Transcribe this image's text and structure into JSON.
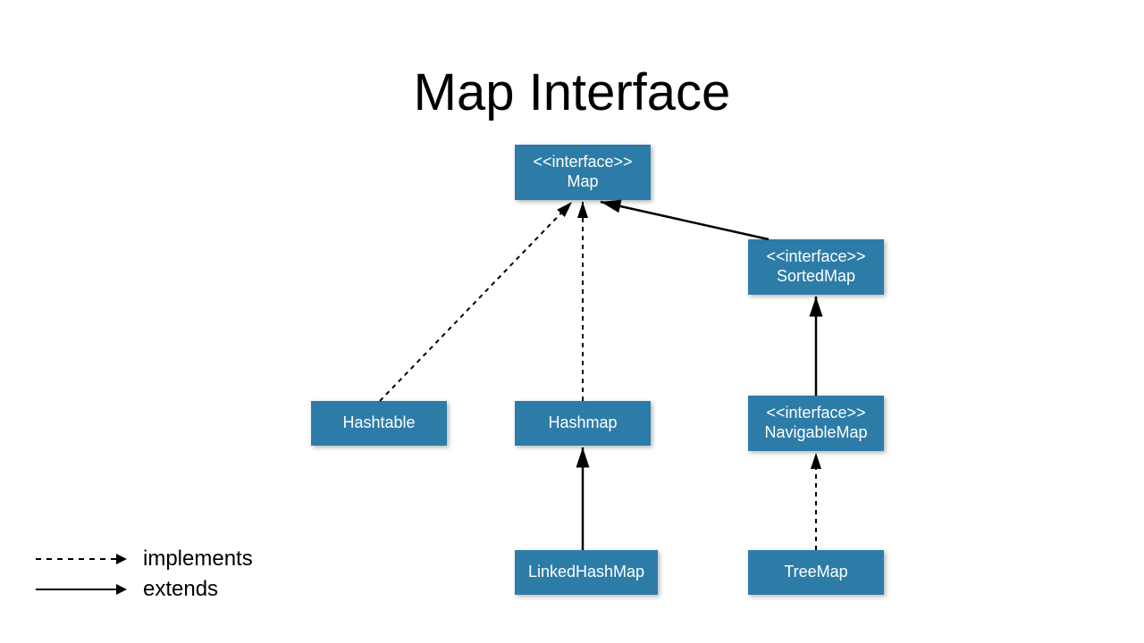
{
  "title": "Map Interface",
  "nodes": {
    "map": {
      "stereotype": "<<interface>>",
      "name": "Map"
    },
    "sortedmap": {
      "stereotype": "<<interface>>",
      "name": "SortedMap"
    },
    "hashtable": {
      "name": "Hashtable"
    },
    "hashmap": {
      "name": "Hashmap"
    },
    "navigablemap": {
      "stereotype": "<<interface>>",
      "name": "NavigableMap"
    },
    "linkedhashmap": {
      "name": "LinkedHashMap"
    },
    "treemap": {
      "name": "TreeMap"
    }
  },
  "legend": {
    "implements": "implements",
    "extends": "extends"
  },
  "edges": [
    {
      "from": "hashtable",
      "to": "map",
      "type": "implements"
    },
    {
      "from": "hashmap",
      "to": "map",
      "type": "implements"
    },
    {
      "from": "sortedmap",
      "to": "map",
      "type": "extends"
    },
    {
      "from": "navigablemap",
      "to": "sortedmap",
      "type": "extends"
    },
    {
      "from": "linkedhashmap",
      "to": "hashmap",
      "type": "extends"
    },
    {
      "from": "treemap",
      "to": "navigablemap",
      "type": "implements"
    }
  ]
}
